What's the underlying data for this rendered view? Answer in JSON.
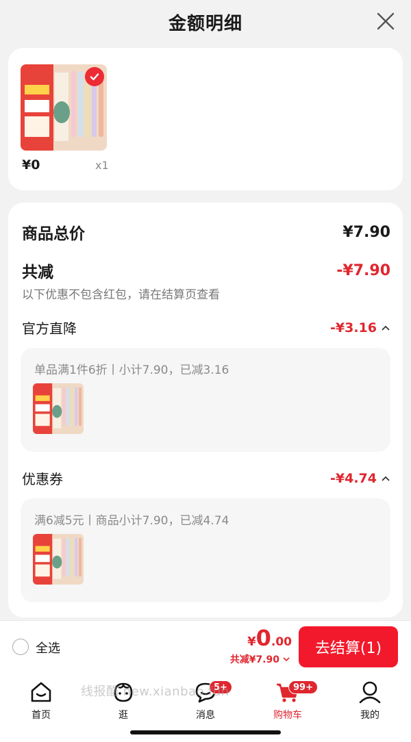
{
  "header": {
    "title": "金额明细"
  },
  "product": {
    "price": "¥0",
    "quantity": "x1"
  },
  "summary": {
    "total_label": "商品总价",
    "total_value": "¥7.90",
    "reduce_label": "共减",
    "reduce_value": "-¥7.90",
    "note": "以下优惠不包含红包，请在结算页查看"
  },
  "discounts": [
    {
      "label": "官方直降",
      "value": "-¥3.16",
      "detail": "单品满1件6折丨小计7.90，已减3.16"
    },
    {
      "label": "优惠券",
      "value": "-¥4.74",
      "detail": "满6减5元丨商品小计7.90，已减4.74"
    }
  ],
  "checkout": {
    "select_all": "全选",
    "currency": "¥",
    "amount_int": "0",
    "amount_dec": ".00",
    "saved": "共减¥7.90",
    "button": "去结算(1)"
  },
  "tabs": [
    {
      "label": "首页",
      "icon": "home-icon"
    },
    {
      "label": "逛",
      "icon": "browse-icon"
    },
    {
      "label": "消息",
      "icon": "message-icon",
      "badge": "5+"
    },
    {
      "label": "购物车",
      "icon": "cart-icon",
      "badge": "99+",
      "active": true
    },
    {
      "label": "我的",
      "icon": "profile-icon"
    }
  ],
  "watermark": "线报酷 new.xianbao.fun",
  "colors": {
    "accent": "#e0262f",
    "button": "#f3192c",
    "background": "#f2f2f2"
  }
}
